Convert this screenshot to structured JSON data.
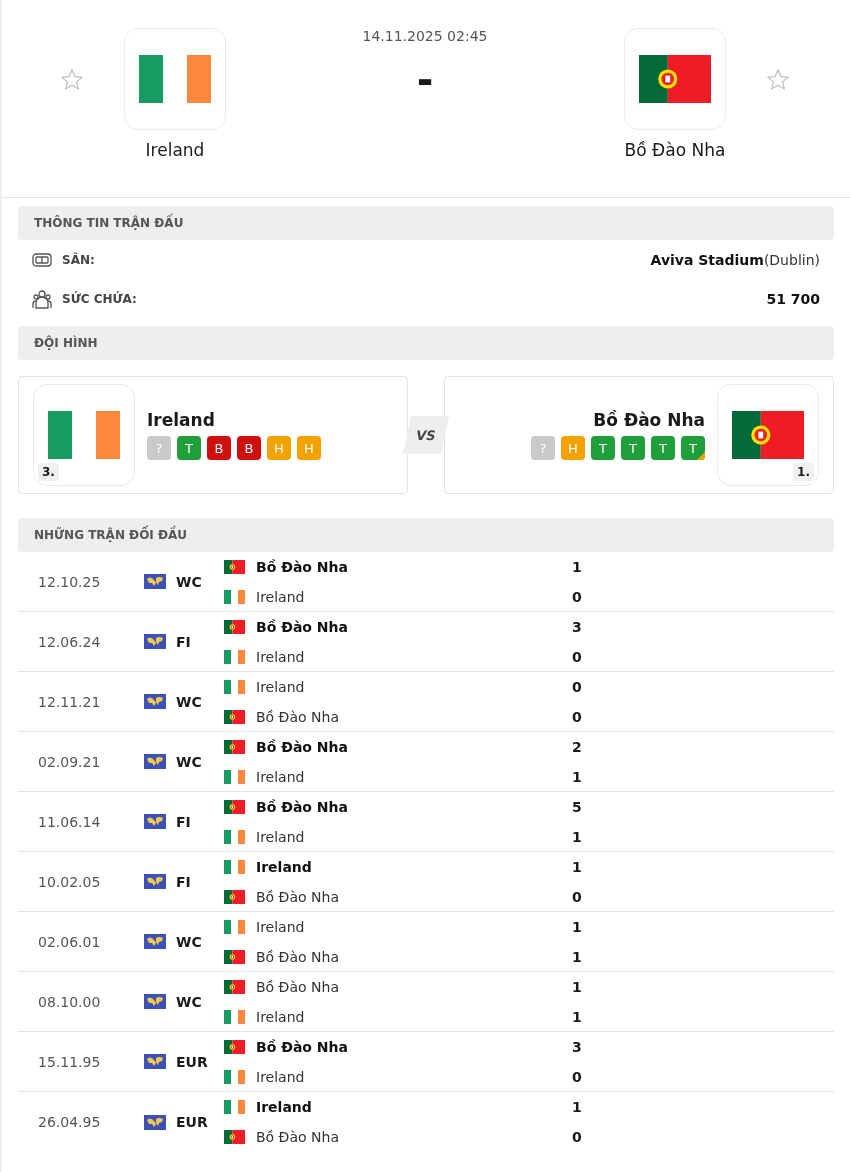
{
  "match": {
    "datetime": "14.11.2025 02:45",
    "score": "-",
    "home": {
      "name": "Ireland",
      "kind": "ireland",
      "favorite": false
    },
    "away": {
      "name": "Bồ Đào Nha",
      "kind": "portugal",
      "favorite": false
    }
  },
  "match_info": {
    "title": "THÔNG TIN TRẬN ĐẤU",
    "rows": [
      {
        "kind": "stadium",
        "label": "SÂN:",
        "value": "Aviva Stadium",
        "detail": "(Dublin)"
      },
      {
        "kind": "capacity",
        "label": "SỨC CHỨA:",
        "value": "51 700"
      }
    ]
  },
  "lineups": {
    "title": "ĐỘI HÌNH",
    "vs": "VS",
    "teams": [
      {
        "name": "Ireland",
        "kind": "ireland",
        "rank": "3.",
        "form": [
          {
            "result": "?",
            "kind": "unknown",
            "marked": false
          },
          {
            "result": "T",
            "kind": "win",
            "marked": false
          },
          {
            "result": "B",
            "kind": "loss",
            "marked": false
          },
          {
            "result": "B",
            "kind": "loss",
            "marked": false
          },
          {
            "result": "H",
            "kind": "draw",
            "marked": false
          },
          {
            "result": "H",
            "kind": "draw",
            "marked": false
          }
        ]
      },
      {
        "name": "Bồ Đào Nha",
        "kind": "portugal",
        "rank": "1.",
        "form": [
          {
            "result": "?",
            "kind": "unknown",
            "marked": false
          },
          {
            "result": "H",
            "kind": "draw",
            "marked": false
          },
          {
            "result": "T",
            "kind": "win",
            "marked": false
          },
          {
            "result": "T",
            "kind": "win",
            "marked": false
          },
          {
            "result": "T",
            "kind": "win",
            "marked": false
          },
          {
            "result": "T",
            "kind": "win",
            "marked": true
          }
        ]
      }
    ]
  },
  "head_to_head": {
    "title": "NHỮNG TRẬN ĐỐI ĐẦU",
    "matches": [
      {
        "date": "12.10.25",
        "competition": "WC",
        "teams": [
          {
            "name": "Bồ Đào Nha",
            "kind": "portugal",
            "score": "1",
            "winner": true
          },
          {
            "name": "Ireland",
            "kind": "ireland",
            "score": "0",
            "winner": false
          }
        ]
      },
      {
        "date": "12.06.24",
        "competition": "FI",
        "teams": [
          {
            "name": "Bồ Đào Nha",
            "kind": "portugal",
            "score": "3",
            "winner": true
          },
          {
            "name": "Ireland",
            "kind": "ireland",
            "score": "0",
            "winner": false
          }
        ]
      },
      {
        "date": "12.11.21",
        "competition": "WC",
        "teams": [
          {
            "name": "Ireland",
            "kind": "ireland",
            "score": "0",
            "winner": false
          },
          {
            "name": "Bồ Đào Nha",
            "kind": "portugal",
            "score": "0",
            "winner": false
          }
        ]
      },
      {
        "date": "02.09.21",
        "competition": "WC",
        "teams": [
          {
            "name": "Bồ Đào Nha",
            "kind": "portugal",
            "score": "2",
            "winner": true
          },
          {
            "name": "Ireland",
            "kind": "ireland",
            "score": "1",
            "winner": false
          }
        ]
      },
      {
        "date": "11.06.14",
        "competition": "FI",
        "teams": [
          {
            "name": "Bồ Đào Nha",
            "kind": "portugal",
            "score": "5",
            "winner": true
          },
          {
            "name": "Ireland",
            "kind": "ireland",
            "score": "1",
            "winner": false
          }
        ]
      },
      {
        "date": "10.02.05",
        "competition": "FI",
        "teams": [
          {
            "name": "Ireland",
            "kind": "ireland",
            "score": "1",
            "winner": true
          },
          {
            "name": "Bồ Đào Nha",
            "kind": "portugal",
            "score": "0",
            "winner": false
          }
        ]
      },
      {
        "date": "02.06.01",
        "competition": "WC",
        "teams": [
          {
            "name": "Ireland",
            "kind": "ireland",
            "score": "1",
            "winner": false
          },
          {
            "name": "Bồ Đào Nha",
            "kind": "portugal",
            "score": "1",
            "winner": false
          }
        ]
      },
      {
        "date": "08.10.00",
        "competition": "WC",
        "teams": [
          {
            "name": "Bồ Đào Nha",
            "kind": "portugal",
            "score": "1",
            "winner": false
          },
          {
            "name": "Ireland",
            "kind": "ireland",
            "score": "1",
            "winner": false
          }
        ]
      },
      {
        "date": "15.11.95",
        "competition": "EUR",
        "teams": [
          {
            "name": "Bồ Đào Nha",
            "kind": "portugal",
            "score": "3",
            "winner": true
          },
          {
            "name": "Ireland",
            "kind": "ireland",
            "score": "0",
            "winner": false
          }
        ]
      },
      {
        "date": "26.04.95",
        "competition": "EUR",
        "teams": [
          {
            "name": "Ireland",
            "kind": "ireland",
            "score": "1",
            "winner": true
          },
          {
            "name": "Bồ Đào Nha",
            "kind": "portugal",
            "score": "0",
            "winner": false
          }
        ]
      }
    ]
  }
}
